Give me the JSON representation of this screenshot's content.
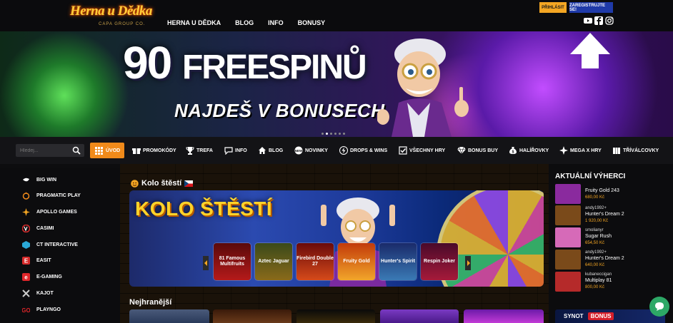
{
  "header": {
    "logo_text": "Herna u Dědka",
    "logo_sub": "CAPA GROUP CO.",
    "nav": [
      "HERNA U DĚDKA",
      "BLOG",
      "INFO",
      "BONUSY"
    ],
    "login_label": "PŘIHLÁSIT",
    "register_label": "ZAREGISTRUJTE SE!"
  },
  "hero": {
    "headline_num": "90",
    "headline_word": "FREESPINŮ",
    "subline": "NAJDEŠ V BONUSECH"
  },
  "search": {
    "placeholder": "Hledej..."
  },
  "categories": [
    {
      "label": "ÚVOD",
      "icon": "grid-icon",
      "active": true
    },
    {
      "label": "PROMOKÓDY",
      "icon": "gift-icon"
    },
    {
      "label": "TREFA",
      "icon": "trophy-icon"
    },
    {
      "label": "INFO",
      "icon": "chat-icon"
    },
    {
      "label": "BLOG",
      "icon": "home-icon"
    },
    {
      "label": "NOVINKY",
      "icon": "new-icon"
    },
    {
      "label": "DROPS & WINS",
      "icon": "bolt-icon"
    },
    {
      "label": "VŠECHNY HRY",
      "icon": "check-icon"
    },
    {
      "label": "BONUS BUY",
      "icon": "diamond-icon"
    },
    {
      "label": "HALÍŘOVKY",
      "icon": "money-bag-icon"
    },
    {
      "label": "MEGA X HRY",
      "icon": "mega-icon"
    },
    {
      "label": "TŘÍVÁLCOVKY",
      "icon": "bars-icon"
    }
  ],
  "providers": [
    "BIG WIN",
    "PRAGMATIC PLAY",
    "APOLLO GAMES",
    "CASIMI",
    "CT INTERACTIVE",
    "EASIT",
    "E-GAMING",
    "KAJOT",
    "PLAYNGO"
  ],
  "main": {
    "kolo_title": "Kolo štěstí",
    "kolo_banner_text": "KOLO ŠTĚSTÍ",
    "games": [
      "81 Famous Multifruits",
      "Aztec Jaguar",
      "Firebird Double 27",
      "Fruity Gold",
      "Hunter's Spirit",
      "Respin Joker"
    ],
    "nejhranejsi_title": "Nejhranější"
  },
  "winners": {
    "title": "AKTUÁLNÍ VÝHERCI",
    "items": [
      {
        "user": "",
        "game": "Fruity Gold 243",
        "amount": "680,00 Kč",
        "color": "#8a2a9e"
      },
      {
        "user": "andy1992+",
        "game": "Hunter's Dream 2",
        "amount": "1 920,00 Kč",
        "color": "#7a4a1a"
      },
      {
        "user": "smolianyr",
        "game": "Sugar Rush",
        "amount": "654,50 Kč",
        "color": "#d66ab8"
      },
      {
        "user": "andy1992+",
        "game": "Hunter's Dream 2",
        "amount": "640,00 Kč",
        "color": "#7a4a1a"
      },
      {
        "user": "kubaneccigan",
        "game": "Multiplay 81",
        "amount": "800,00 Kč",
        "color": "#b52a2a"
      }
    ],
    "banner_brand": "SYNOT",
    "banner_bonus": "BONUS"
  },
  "colors": {
    "accent": "#f08a1a",
    "login": "#f4a623",
    "register": "#1f3aa8",
    "chat": "#2da866"
  }
}
